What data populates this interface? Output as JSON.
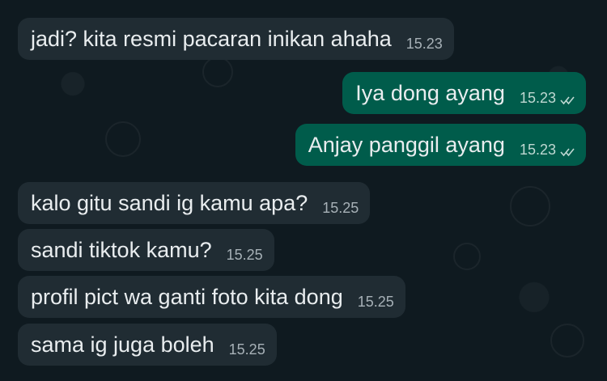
{
  "chat": {
    "messages": [
      {
        "text": "jadi? kita resmi pacaran inikan ahaha",
        "time": "15.23",
        "direction": "incoming"
      },
      {
        "text": "Iya dong ayang",
        "time": "15.23",
        "direction": "outgoing",
        "status": "read-ticks-icon"
      },
      {
        "text": "Anjay panggil ayang",
        "time": "15.23",
        "direction": "outgoing",
        "status": "read-ticks-icon"
      },
      {
        "text": "kalo gitu sandi ig kamu apa?",
        "time": "15.25",
        "direction": "incoming"
      },
      {
        "text": "sandi tiktok kamu?",
        "time": "15.25",
        "direction": "incoming"
      },
      {
        "text": "profil pict wa ganti foto kita dong",
        "time": "15.25",
        "direction": "incoming"
      },
      {
        "text": "sama ig juga boleh",
        "time": "15.25",
        "direction": "incoming"
      }
    ]
  },
  "colors": {
    "background": "#0f1a20",
    "incoming_bubble": "#202c33",
    "outgoing_bubble": "#005c4b",
    "text": "#e9edef"
  }
}
